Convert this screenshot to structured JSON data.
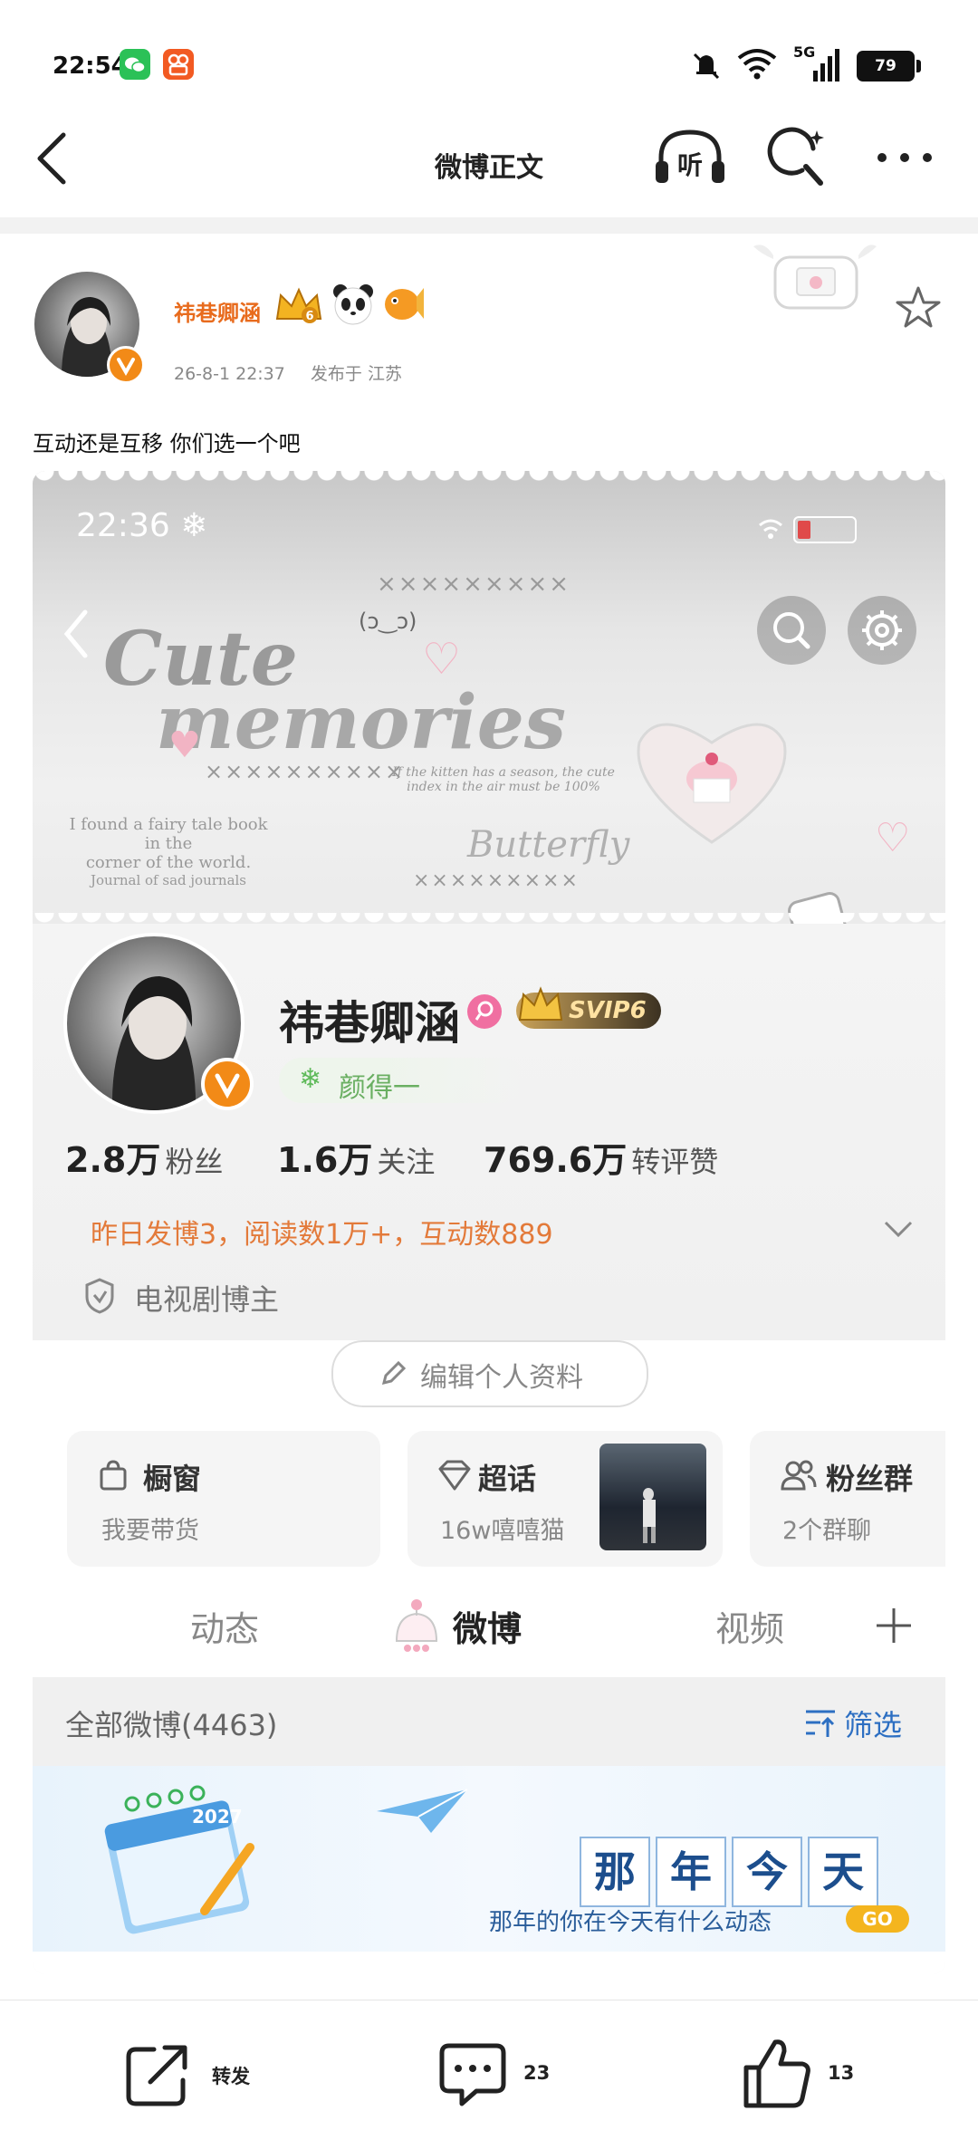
{
  "status_bar": {
    "time": "22:54",
    "network": "5G",
    "battery": "79"
  },
  "nav": {
    "title": "微博正文"
  },
  "post": {
    "author": "祎巷卿涵",
    "time": "26-8-1 22:37",
    "location_label": "发布于 江苏",
    "text": "互动还是互移 你们选一个吧"
  },
  "screenshot": {
    "time": "22:36 ❄",
    "banner_title_1": "Cute",
    "banner_title_2": "memories",
    "banner_cross_1": "×××××××××",
    "banner_cross_2": "××××××××××",
    "banner_cross_3": "×××××××××",
    "banner_face": "(ɔ‿ɔ)",
    "banner_quote_1": "I found a fairy tale book in the",
    "banner_quote_2": "corner of the world.",
    "banner_quote_3": "Journal of sad journals",
    "banner_kitten_1": "If the kitten has a season, the cute",
    "banner_kitten_2": "index in the air must be 100%",
    "banner_butterfly": "Butterfly",
    "profile_name": "祎巷卿涵",
    "svip": "SVIP6",
    "tag": "颜得一",
    "stats": [
      {
        "num": "2.8万",
        "label": "粉丝"
      },
      {
        "num": "1.6万",
        "label": "关注"
      },
      {
        "num": "769.6万",
        "label": "转评赞"
      }
    ],
    "activity": "昨日发博3，阅读数1万+，互动数889",
    "verify": "电视剧博主",
    "edit_profile": "编辑个人资料",
    "cards": [
      {
        "title": "橱窗",
        "sub": "我要带货"
      },
      {
        "title": "超话",
        "sub": "16w嘻嘻猫"
      },
      {
        "title": "粉丝群",
        "sub": "2个群聊"
      }
    ],
    "tabs": [
      "动态",
      "微博",
      "视频"
    ],
    "all_posts": "全部微博(4463)",
    "filter": "筛选",
    "memory_year": "2027",
    "memory_chars": [
      "那",
      "年",
      "今",
      "天"
    ],
    "memory_text": "那年的你在今天有什么动态",
    "memory_go": "GO"
  },
  "bottom_bar": {
    "repost_label": "转发",
    "comment_count": "23",
    "like_count": "13"
  },
  "colors": {
    "accent_orange": "#e86b1d",
    "activity_orange": "#e37a3a",
    "blue": "#2d6fc2"
  }
}
